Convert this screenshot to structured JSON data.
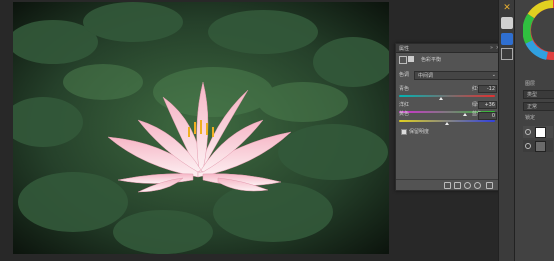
{
  "colors": {
    "app_bg": "#282828",
    "panel_bg": "#535353",
    "cyan_red": [
      "#00b4b4",
      "#e03030"
    ],
    "magenta_green": [
      "#d030d0",
      "#30c030"
    ],
    "yellow_blue": [
      "#e0d020",
      "#3040e0"
    ]
  },
  "panel": {
    "title": "属性",
    "layer_label": "色彩平衡",
    "tone_label": "色调",
    "tone_value": "中间调",
    "sliders": [
      {
        "left": "青色",
        "right": "红色",
        "value": "-12",
        "position": 0.44
      },
      {
        "left": "洋红",
        "right": "绿色",
        "value": "+36",
        "position": 0.68
      },
      {
        "left": "黄色",
        "right": "蓝色",
        "value": "0",
        "position": 0.5
      }
    ],
    "preserve_luminosity": "保留明度",
    "preserve_checked": true
  },
  "right_panel": {
    "tab_label": "图层",
    "kind_label": "类型",
    "mode_label": "正常",
    "lock_label": "锁定"
  },
  "icons": [
    "close-icon",
    "color-wheel-icon",
    "clip-icon",
    "eye-icon",
    "undo-icon",
    "reset-icon",
    "visibility-icon",
    "trash-icon"
  ]
}
